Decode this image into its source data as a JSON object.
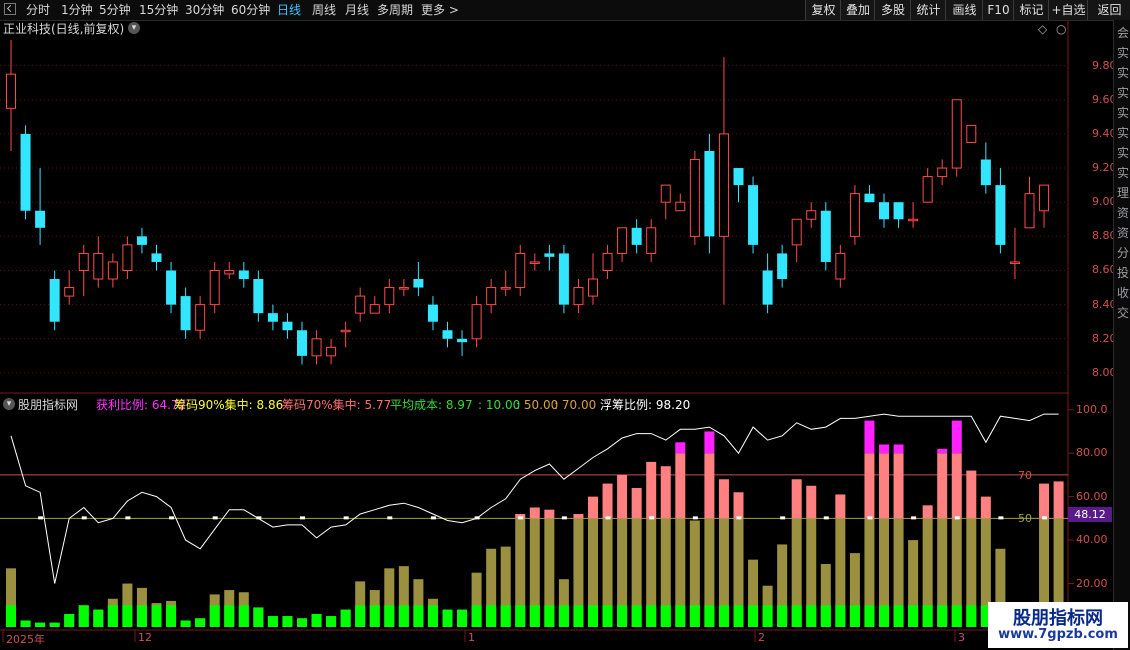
{
  "toolbar": {
    "periods": [
      "分时",
      "1分钟",
      "5分钟",
      "15分钟",
      "30分钟",
      "60分钟",
      "日线",
      "周线",
      "月线",
      "多周期",
      "更多 >"
    ],
    "active_period": "日线",
    "buttons": [
      "复权",
      "叠加",
      "多股",
      "统计",
      "画线",
      "F10",
      "标记",
      "+自选",
      "返回"
    ]
  },
  "stock": {
    "title": "正业科技(日线,前复权)"
  },
  "price_axis": [
    "9.80",
    "9.60",
    "9.40",
    "9.20",
    "9.00",
    "8.80",
    "8.60",
    "8.40",
    "8.20",
    "8.00"
  ],
  "indicator": {
    "name": "股朋指标网",
    "values": [
      {
        "label": "获利比例:",
        "value": "64.72",
        "color": "#ff33ff"
      },
      {
        "label": "筹码90%集中:",
        "value": "8.86",
        "color": "#ffff33"
      },
      {
        "label": "筹码70%集中:",
        "value": "5.77",
        "color": "#ff6e6e"
      },
      {
        "label": "平均成本:",
        "value": "8.97",
        "color": "#33dd33"
      },
      {
        "label": ":",
        "value": "10.00",
        "color": "#33dd33"
      },
      {
        "label": ":",
        "value": "50.00",
        "color": "#d8a040"
      },
      {
        "label": ":",
        "value": "70.00",
        "color": "#d8a040"
      },
      {
        "label": "浮筹比例:",
        "value": "98.20",
        "color": "#ffffff"
      }
    ],
    "axis": [
      "100.0",
      "80.00",
      "60.00",
      "40.00",
      "20.00"
    ],
    "line_labels": {
      "seventy": "70",
      "fifty": "50"
    },
    "current_value": "48.12"
  },
  "dates": [
    "2025年",
    "12",
    "1",
    "2",
    "3"
  ],
  "right_strip_chars": [
    "会",
    "实",
    "实",
    "实",
    "实",
    "实",
    "实",
    "实",
    "理",
    "资",
    "资",
    "分",
    "投",
    "收",
    "交"
  ],
  "watermark": {
    "title": "股朋指标网",
    "url": "www.7gpzb.com"
  },
  "colors": {
    "up": "#ff4a4a",
    "down": "#33e6ff",
    "fifty_bar": "#9a9040",
    "pink_bar": "#ff8080",
    "magenta_bar": "#ff22ff",
    "green_bar": "#00ff00",
    "grid": "#5a1010"
  },
  "chart_data": {
    "type": "candlestick",
    "price_ylim": [
      7.9,
      9.95
    ],
    "candles": [
      [
        9.55,
        9.75,
        9.95,
        9.3
      ],
      [
        9.4,
        8.95,
        9.45,
        8.9
      ],
      [
        8.95,
        8.85,
        9.2,
        8.75
      ],
      [
        8.55,
        8.3,
        8.6,
        8.25
      ],
      [
        8.45,
        8.5,
        8.6,
        8.4
      ],
      [
        8.6,
        8.7,
        8.75,
        8.45
      ],
      [
        8.55,
        8.7,
        8.8,
        8.5
      ],
      [
        8.55,
        8.65,
        8.7,
        8.5
      ],
      [
        8.6,
        8.75,
        8.8,
        8.55
      ],
      [
        8.8,
        8.75,
        8.85,
        8.7
      ],
      [
        8.7,
        8.65,
        8.75,
        8.6
      ],
      [
        8.6,
        8.4,
        8.65,
        8.35
      ],
      [
        8.45,
        8.25,
        8.5,
        8.2
      ],
      [
        8.25,
        8.4,
        8.45,
        8.2
      ],
      [
        8.4,
        8.6,
        8.65,
        8.35
      ],
      [
        8.58,
        8.6,
        8.65,
        8.55
      ],
      [
        8.6,
        8.55,
        8.65,
        8.5
      ],
      [
        8.55,
        8.35,
        8.6,
        8.3
      ],
      [
        8.35,
        8.3,
        8.4,
        8.25
      ],
      [
        8.3,
        8.25,
        8.35,
        8.2
      ],
      [
        8.25,
        8.1,
        8.3,
        8.05
      ],
      [
        8.1,
        8.2,
        8.25,
        8.05
      ],
      [
        8.1,
        8.15,
        8.2,
        8.05
      ],
      [
        8.25,
        8.25,
        8.3,
        8.15
      ],
      [
        8.35,
        8.45,
        8.5,
        8.3
      ],
      [
        8.35,
        8.4,
        8.45,
        8.35
      ],
      [
        8.4,
        8.5,
        8.55,
        8.35
      ],
      [
        8.5,
        8.5,
        8.55,
        8.45
      ],
      [
        8.55,
        8.5,
        8.65,
        8.45
      ],
      [
        8.4,
        8.3,
        8.45,
        8.25
      ],
      [
        8.25,
        8.2,
        8.3,
        8.15
      ],
      [
        8.2,
        8.18,
        8.25,
        8.1
      ],
      [
        8.2,
        8.4,
        8.45,
        8.15
      ],
      [
        8.4,
        8.5,
        8.55,
        8.35
      ],
      [
        8.5,
        8.5,
        8.6,
        8.45
      ],
      [
        8.5,
        8.7,
        8.75,
        8.45
      ],
      [
        8.65,
        8.65,
        8.7,
        8.6
      ],
      [
        8.7,
        8.68,
        8.75,
        8.6
      ],
      [
        8.7,
        8.4,
        8.75,
        8.35
      ],
      [
        8.4,
        8.5,
        8.55,
        8.35
      ],
      [
        8.45,
        8.55,
        8.7,
        8.4
      ],
      [
        8.6,
        8.7,
        8.75,
        8.55
      ],
      [
        8.7,
        8.85,
        8.85,
        8.65
      ],
      [
        8.85,
        8.75,
        8.9,
        8.7
      ],
      [
        8.7,
        8.85,
        8.9,
        8.65
      ],
      [
        9.0,
        9.1,
        9.1,
        8.9
      ],
      [
        8.95,
        9.0,
        9.05,
        8.95
      ],
      [
        8.8,
        9.25,
        9.3,
        8.75
      ],
      [
        9.3,
        8.8,
        9.4,
        8.7
      ],
      [
        8.8,
        9.4,
        9.85,
        8.4
      ],
      [
        9.2,
        9.1,
        9.2,
        9.0
      ],
      [
        9.1,
        8.75,
        9.15,
        8.7
      ],
      [
        8.6,
        8.4,
        8.7,
        8.35
      ],
      [
        8.7,
        8.55,
        8.75,
        8.5
      ],
      [
        8.75,
        8.9,
        8.9,
        8.65
      ],
      [
        8.9,
        8.95,
        9.0,
        8.85
      ],
      [
        8.95,
        8.65,
        9.0,
        8.6
      ],
      [
        8.55,
        8.7,
        8.75,
        8.5
      ],
      [
        8.8,
        9.05,
        9.1,
        8.75
      ],
      [
        9.05,
        9.0,
        9.1,
        9.0
      ],
      [
        9.0,
        8.9,
        9.05,
        8.85
      ],
      [
        9.0,
        8.9,
        9.0,
        8.85
      ],
      [
        8.9,
        8.9,
        9.0,
        8.85
      ],
      [
        9.0,
        9.15,
        9.2,
        9.0
      ],
      [
        9.15,
        9.2,
        9.25,
        9.1
      ],
      [
        9.2,
        9.6,
        9.6,
        9.15
      ],
      [
        9.35,
        9.45,
        9.45,
        9.35
      ],
      [
        9.25,
        9.1,
        9.35,
        9.05
      ],
      [
        9.1,
        8.75,
        9.2,
        8.7
      ],
      [
        8.65,
        8.65,
        8.85,
        8.55
      ],
      [
        8.85,
        9.05,
        9.15,
        8.85
      ],
      [
        8.95,
        9.1,
        9.1,
        8.85
      ]
    ],
    "float_ratio": [
      88,
      65,
      62,
      20,
      50,
      55,
      48,
      50,
      58,
      62,
      60,
      55,
      40,
      36,
      45,
      54,
      54,
      50,
      46,
      47,
      47,
      41,
      46,
      47,
      52,
      54,
      56,
      57,
      55,
      52,
      49,
      48,
      50,
      55,
      59,
      68,
      72,
      75,
      68,
      73,
      78,
      82,
      87,
      89,
      89,
      86,
      91,
      91,
      92,
      88,
      80,
      92,
      86,
      88,
      94,
      91,
      92,
      96,
      96,
      97,
      98,
      97,
      97,
      97,
      97,
      97,
      97,
      85,
      97,
      96,
      95,
      98,
      98
    ],
    "profit_ratio": [
      27,
      3,
      2,
      2,
      6,
      10,
      8,
      13,
      20,
      18,
      11,
      12,
      3,
      4,
      15,
      17,
      16,
      9,
      5,
      5,
      4,
      6,
      5,
      8,
      21,
      17,
      27,
      28,
      22,
      13,
      8,
      8,
      25,
      36,
      37,
      52,
      55,
      54,
      22,
      52,
      60,
      66,
      70,
      64,
      76,
      74,
      85,
      49,
      90,
      68,
      62,
      31,
      19,
      38,
      68,
      65,
      29,
      61,
      34,
      95,
      84,
      84,
      40,
      56,
      82,
      95,
      72,
      60,
      36,
      10,
      5,
      66,
      67
    ]
  }
}
